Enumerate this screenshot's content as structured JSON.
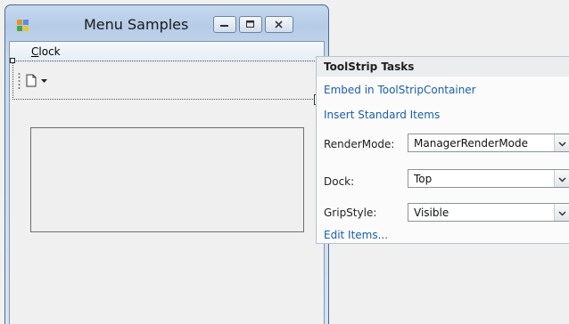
{
  "form": {
    "title": "Menu Samples",
    "menu": {
      "clock": {
        "accel": "C",
        "rest": "lock"
      }
    }
  },
  "task_panel": {
    "title": "ToolStrip Tasks",
    "links": {
      "embed": "Embed in ToolStripContainer",
      "insert": "Insert Standard Items",
      "edit": "Edit Items..."
    },
    "properties": {
      "render_mode": {
        "label": "RenderMode:",
        "value": "ManagerRenderMode"
      },
      "dock": {
        "label": "Dock:",
        "value": "Top"
      },
      "grip_style": {
        "label": "GripStyle:",
        "value": "Visible"
      }
    }
  },
  "icons": {
    "form_icon": "form-icon",
    "minimize": "minimize-icon",
    "maximize": "maximize-icon",
    "close": "close-icon",
    "tool_button": "new-item-icon",
    "smart_tag": "smart-tag-arrow-icon",
    "dropdown": "chevron-down-icon"
  },
  "colors": {
    "link": "#1a5fa8",
    "window_frame": "#4f6a8f",
    "panel_header": "#ecedef"
  }
}
